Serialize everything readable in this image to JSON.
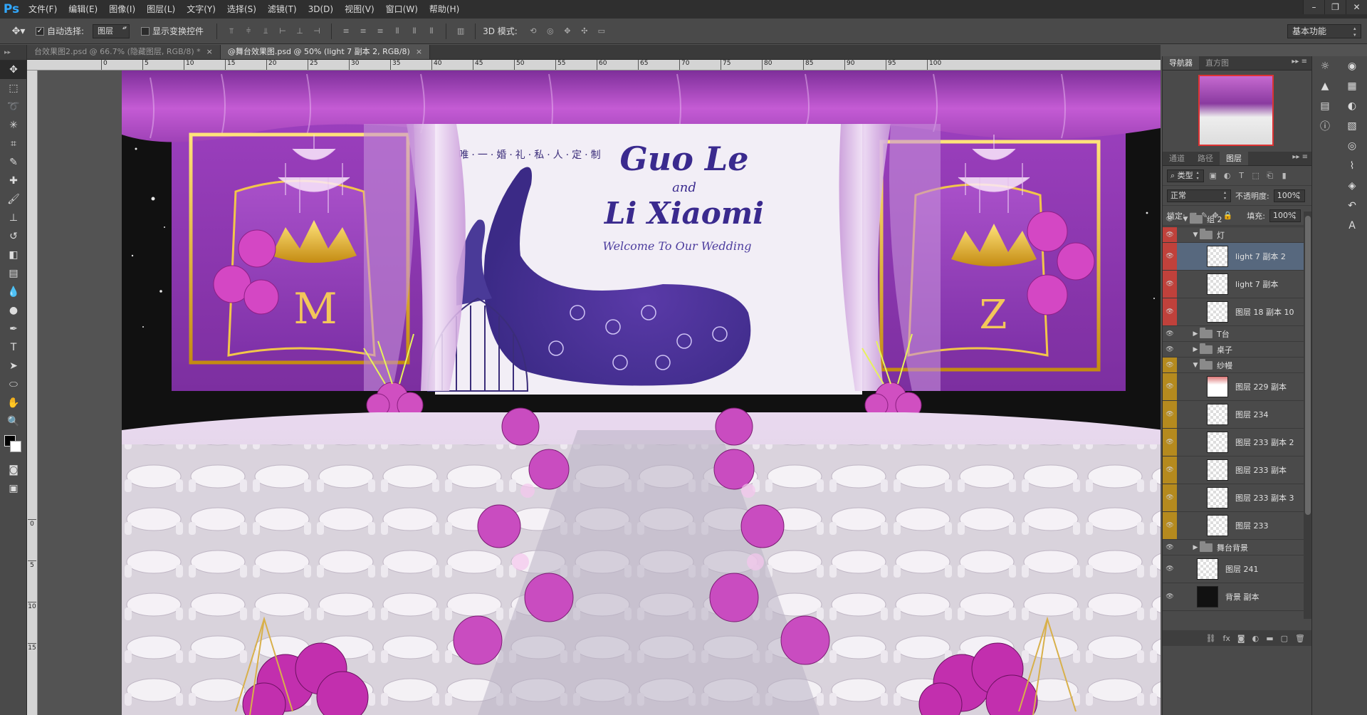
{
  "app": {
    "logo": "Ps"
  },
  "menu": [
    "文件(F)",
    "编辑(E)",
    "图像(I)",
    "图层(L)",
    "文字(Y)",
    "选择(S)",
    "滤镜(T)",
    "3D(D)",
    "视图(V)",
    "窗口(W)",
    "帮助(H)"
  ],
  "window_controls": [
    "minimize-icon",
    "restore-icon",
    "close-icon"
  ],
  "options": {
    "auto_select_label": "自动选择:",
    "auto_select_checked": true,
    "auto_select_value": "图层",
    "show_transform_label": "显示变换控件",
    "show_transform_checked": false,
    "mode_3d_label": "3D 模式:",
    "workspace": "基本功能"
  },
  "tabs": [
    {
      "title": "台效果图2.psd @ 66.7% (隐藏图层, RGB/8) *",
      "active": false
    },
    {
      "title": "@舞台效果图.psd @ 50% (light 7 副本 2, RGB/8)",
      "active": true
    }
  ],
  "ruler_h": [
    "0",
    "5",
    "10",
    "15",
    "20",
    "25",
    "30",
    "35",
    "40",
    "45",
    "50",
    "55",
    "60",
    "65",
    "70",
    "75",
    "80",
    "85",
    "90",
    "95",
    "100"
  ],
  "ruler_v": [
    "0",
    "5",
    "10",
    "15"
  ],
  "canvas": {
    "banner_text": "唯·一·婚·礼·私·人·定·制",
    "name1": "Guo Le",
    "and": "and",
    "name2": "Li Xiaomi",
    "welcome": "Welcome To Our Wedding",
    "left_letter": "M",
    "right_letter": "Z"
  },
  "panels": {
    "top_tabs": [
      "导航器",
      "直方图"
    ],
    "layer_tabs": [
      "通道",
      "路径",
      "图层"
    ],
    "filter_kind": "类型",
    "blend_mode": "正常",
    "opacity_label": "不透明度:",
    "opacity_value": "100%",
    "lock_label": "锁定:",
    "fill_label": "填充:",
    "fill_value": "100%"
  },
  "layers": [
    {
      "name": "组 2",
      "type": "group",
      "open": true,
      "indent": 0,
      "tag": ""
    },
    {
      "name": "灯",
      "type": "group",
      "open": true,
      "indent": 1,
      "tag": "#c0413b"
    },
    {
      "name": "light 7 副本 2",
      "type": "layer",
      "indent": 2,
      "tag": "#c0413b",
      "selected": true
    },
    {
      "name": "light 7 副本",
      "type": "layer",
      "indent": 2,
      "tag": "#c0413b"
    },
    {
      "name": "图层 18 副本 10",
      "type": "layer",
      "indent": 2,
      "tag": "#c0413b"
    },
    {
      "name": "T台",
      "type": "group",
      "open": false,
      "indent": 1,
      "tag": ""
    },
    {
      "name": "桌子",
      "type": "group",
      "open": false,
      "indent": 1,
      "tag": ""
    },
    {
      "name": "纱幔",
      "type": "group",
      "open": true,
      "indent": 1,
      "tag": "#b58a1e"
    },
    {
      "name": "图层 229 副本",
      "type": "layer",
      "indent": 2,
      "tag": "#b58a1e"
    },
    {
      "name": "图层 234",
      "type": "layer",
      "indent": 2,
      "tag": "#b58a1e"
    },
    {
      "name": "图层 233 副本 2",
      "type": "layer",
      "indent": 2,
      "tag": "#b58a1e"
    },
    {
      "name": "图层 233 副本",
      "type": "layer",
      "indent": 2,
      "tag": "#b58a1e"
    },
    {
      "name": "图层 233 副本 3",
      "type": "layer",
      "indent": 2,
      "tag": "#b58a1e"
    },
    {
      "name": "图层 233",
      "type": "layer",
      "indent": 2,
      "tag": "#b58a1e"
    },
    {
      "name": "舞台背景",
      "type": "group",
      "open": false,
      "indent": 1,
      "tag": ""
    },
    {
      "name": "图层 241",
      "type": "layer",
      "indent": 1,
      "tag": ""
    },
    {
      "name": "背景 副本",
      "type": "layer",
      "indent": 1,
      "tag": "",
      "dark": true
    }
  ],
  "colors": {
    "accent_red": "#c0413b",
    "accent_gold": "#b58a1e",
    "selected": "#57687e",
    "ps_blue": "#31a8ff"
  }
}
